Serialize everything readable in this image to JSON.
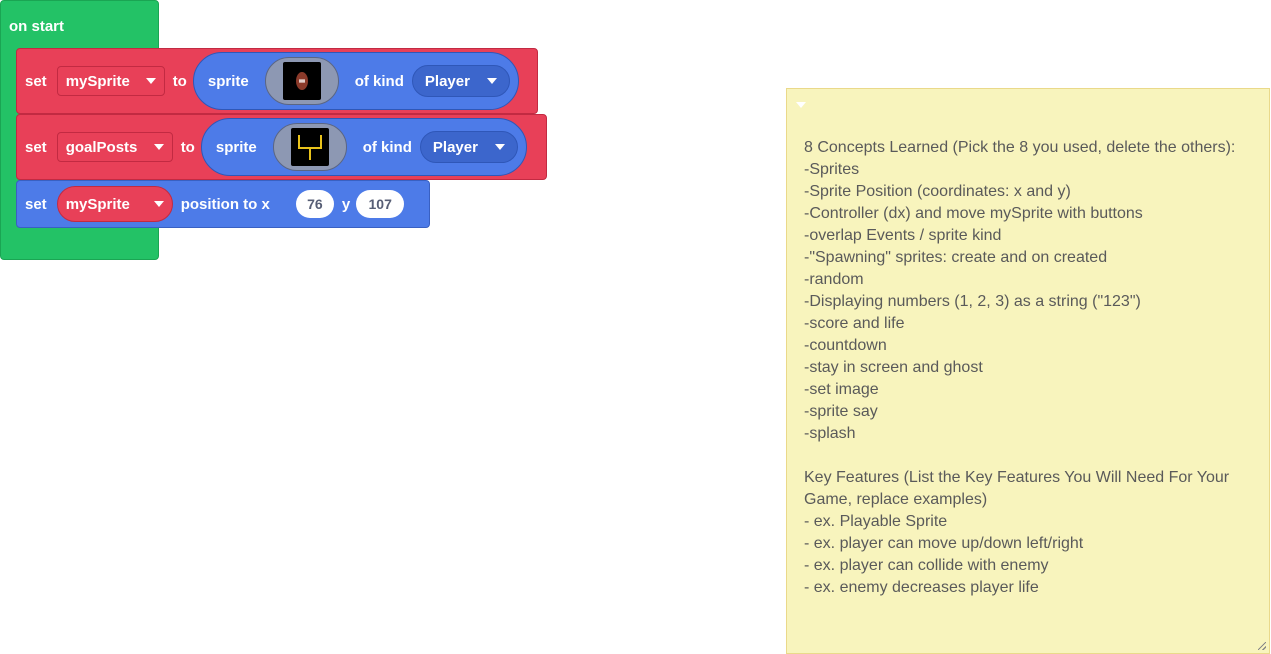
{
  "on_start": {
    "label": "on start"
  },
  "block_set_mysprite": {
    "set_label": "set",
    "variable": "mySprite",
    "to_label": "to",
    "sprite_label": "sprite",
    "of_kind_label": "of kind",
    "kind": "Player"
  },
  "block_set_goalposts": {
    "set_label": "set",
    "variable": "goalPosts",
    "to_label": "to",
    "sprite_label": "sprite",
    "of_kind_label": "of kind",
    "kind": "Player"
  },
  "block_position": {
    "set_label": "set",
    "variable": "mySprite",
    "position_label": "position to x",
    "x_value": "76",
    "y_label": "y",
    "y_value": "107"
  },
  "note": {
    "lines": [
      "8 Concepts Learned (Pick the 8 you used, delete the others):",
      "-Sprites",
      "-Sprite Position (coordinates: x and y)",
      "-Controller (dx) and move mySprite with buttons",
      "-overlap Events / sprite kind",
      "-\"Spawning\" sprites: create and on created",
      "-random",
      "-Displaying numbers (1, 2, 3) as a string (\"123\")",
      "-score and life",
      "-countdown",
      "-stay in screen and ghost",
      "-set image",
      "-sprite say",
      "-splash",
      "",
      "Key Features (List the Key Features You Will Need For Your",
      "Game, replace examples)",
      "- ex. Playable Sprite",
      "- ex. player can move up/down left/right",
      "- ex. player can collide with enemy",
      "- ex. enemy decreases player life"
    ]
  },
  "colors": {
    "event_green": "#23c266",
    "variables_red": "#e84058",
    "sprites_blue": "#4d7be8",
    "note_yellow": "#f8f4bd"
  }
}
